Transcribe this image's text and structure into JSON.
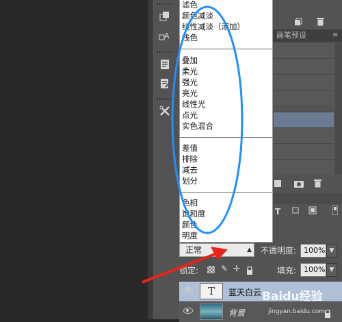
{
  "blend_menu": {
    "groups": [
      [
        "滤色",
        "颜色减淡",
        "线性减淡（添加）",
        "浅色"
      ],
      [
        "叠加",
        "柔光",
        "强光",
        "亮光",
        "线性光",
        "点光",
        "实色混合"
      ],
      [
        "差值",
        "排除",
        "减去",
        "划分"
      ],
      [
        "色相",
        "饱和度",
        "颜色",
        "明度"
      ]
    ]
  },
  "tabs": {
    "brush_presets": "画笔预设"
  },
  "layers_panel": {
    "blend_mode": "正常",
    "opacity_label": "不透明度:",
    "opacity_value": "100%",
    "lock_label": "锁定:",
    "fill_label": "填充:",
    "fill_value": "100%",
    "layers": [
      {
        "type_icon": "T",
        "name": "蓝天白云"
      },
      {
        "name": "背景"
      }
    ]
  },
  "watermark": {
    "text": "Baidu经验",
    "sub": "jingyan.baidu.com"
  },
  "colors": {
    "annotation_blue": "#1e90ff",
    "arrow_red": "#e8231a",
    "selected_row": "#6b7b93"
  }
}
